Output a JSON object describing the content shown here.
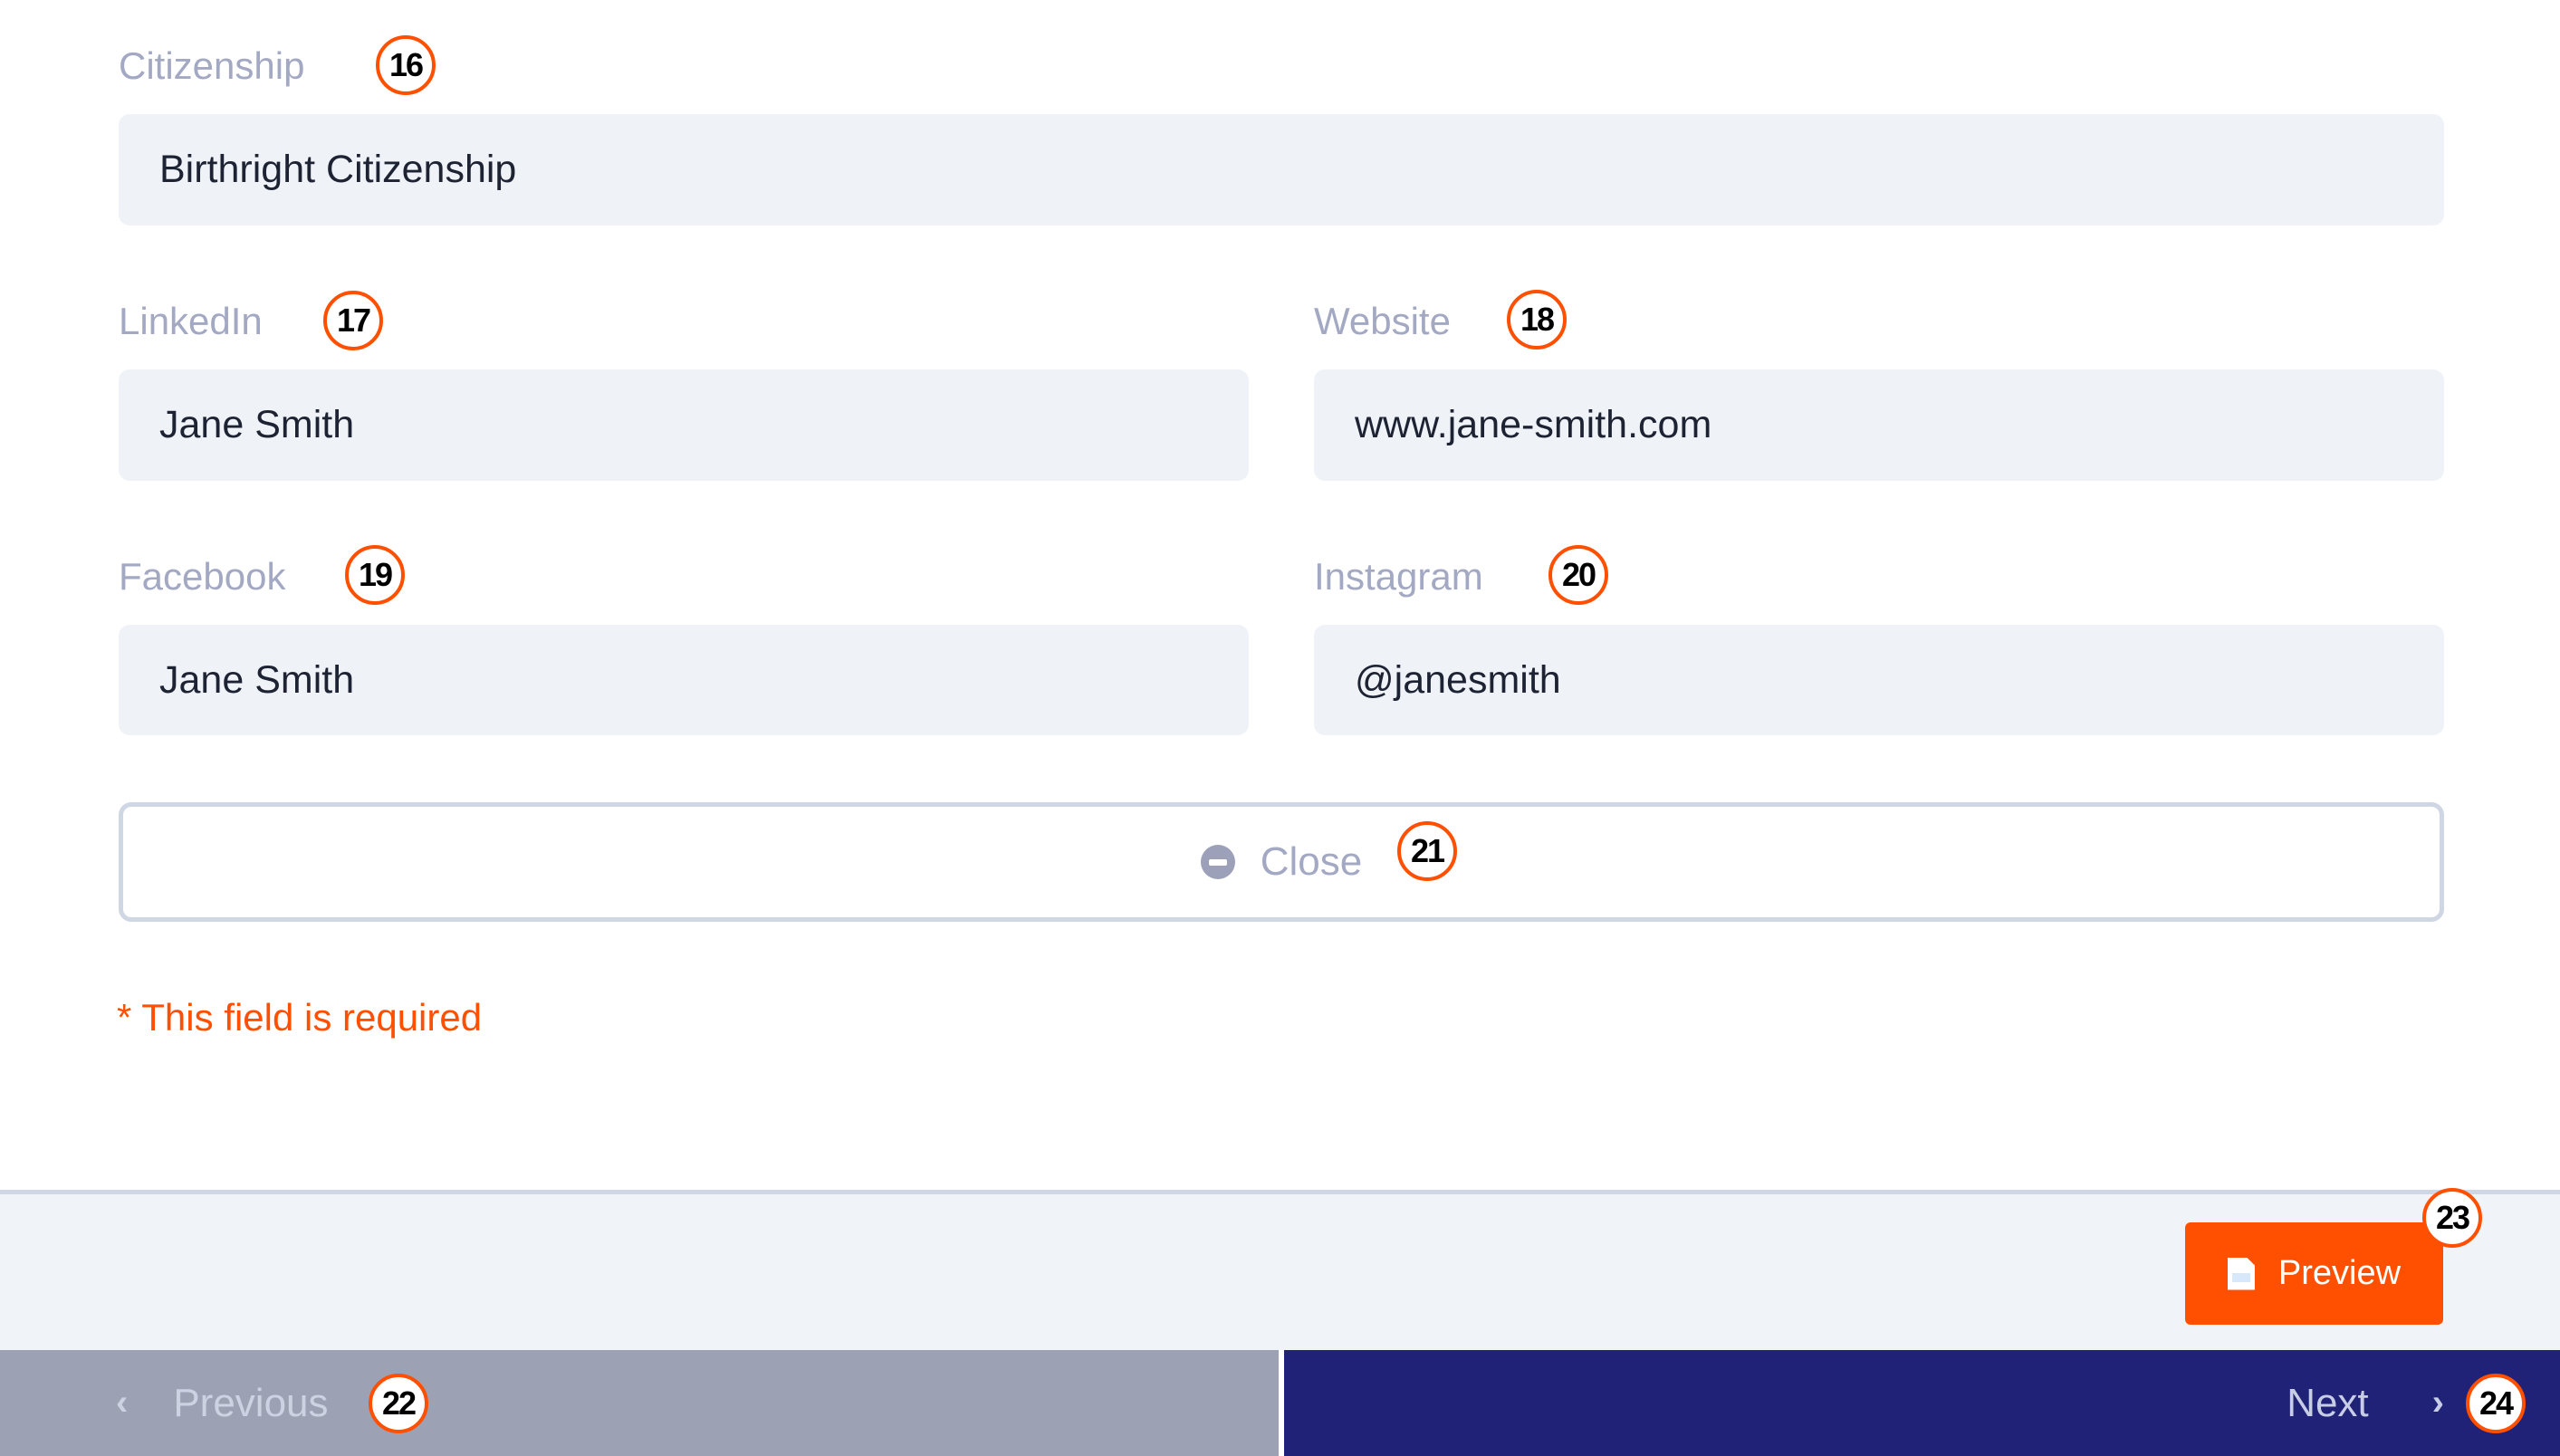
{
  "form": {
    "citizenship": {
      "label": "Citizenship",
      "value": "Birthright Citizenship",
      "badge": "16"
    },
    "linkedin": {
      "label": "LinkedIn",
      "value": "Jane Smith",
      "badge": "17"
    },
    "website": {
      "label": "Website",
      "value": "www.jane-smith.com",
      "badge": "18"
    },
    "facebook": {
      "label": "Facebook",
      "value": "Jane Smith",
      "badge": "19"
    },
    "instagram": {
      "label": "Instagram",
      "value": "@janesmith",
      "badge": "20"
    },
    "close": {
      "label": "Close",
      "icon": "minus-circle-icon",
      "badge": "21"
    },
    "required_note": "* This field is required"
  },
  "footer": {
    "preview": {
      "label": "Preview",
      "icon": "document-icon",
      "badge": "23"
    }
  },
  "nav": {
    "previous": {
      "label": "Previous",
      "icon": "chevron-left-icon",
      "badge": "22"
    },
    "next": {
      "label": "Next",
      "icon": "chevron-right-icon",
      "badge": "24"
    }
  },
  "colors": {
    "accent": "#FF4F00",
    "next_bg": "#1F2277",
    "previous_bg": "#9DA1B4",
    "field_bg": "#EFF3F8",
    "label": "#A3A8C3"
  }
}
